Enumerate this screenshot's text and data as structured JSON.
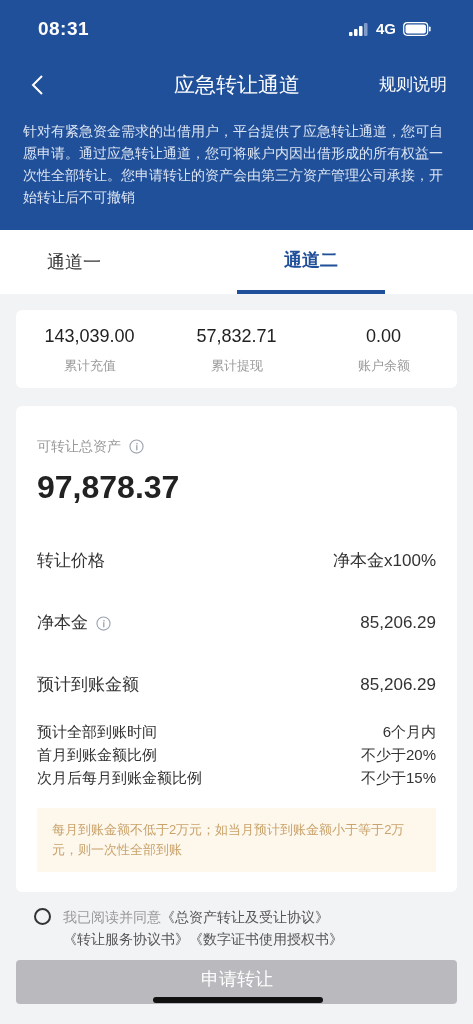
{
  "status_bar": {
    "time": "08:31",
    "network": "4G"
  },
  "nav": {
    "title": "应急转让通道",
    "action": "规则说明"
  },
  "description": "针对有紧急资金需求的出借用户，平台提供了应急转让通道，您可自愿申请。通过应急转让通道，您可将账户内因出借形成的所有权益一次性全部转让。您申请转让的资产会由第三方资产管理公司承接，开始转让后不可撤销",
  "tabs": [
    {
      "label": "通道一",
      "selected": false
    },
    {
      "label": "通道二",
      "selected": true
    }
  ],
  "stats": [
    {
      "value": "143,039.00",
      "label": "累计充值"
    },
    {
      "value": "57,832.71",
      "label": "累计提现"
    },
    {
      "value": "0.00",
      "label": "账户余额"
    }
  ],
  "total": {
    "label": "可转让总资产",
    "value": "97,878.37"
  },
  "rows": [
    {
      "kind": "main",
      "label": "转让价格",
      "value": "净本金x100%",
      "info": false
    },
    {
      "kind": "main",
      "label": "净本金",
      "value": "85,206.29",
      "info": true
    },
    {
      "kind": "main",
      "label": "预计到账金额",
      "value": "85,206.29",
      "info": false
    },
    {
      "kind": "sub",
      "label": "预计全部到账时间",
      "value": "6个月内",
      "info": false
    },
    {
      "kind": "sub",
      "label": "首月到账金额比例",
      "value": "不少于20%",
      "info": false
    },
    {
      "kind": "sub",
      "label": "次月后每月到账金额比例",
      "value": "不少于15%",
      "info": false
    }
  ],
  "notice": "每月到账金额不低于2万元；如当月预计到账金额小于等于2万元，则一次性全部到账",
  "agreement": {
    "checked": false,
    "text": "我已阅读并同意",
    "links": [
      "《总资产转让及受让协议》",
      "《转让服务协议书》",
      "《数字证书使用授权书》"
    ]
  },
  "submit": {
    "label": "申请转让",
    "disabled": true
  }
}
